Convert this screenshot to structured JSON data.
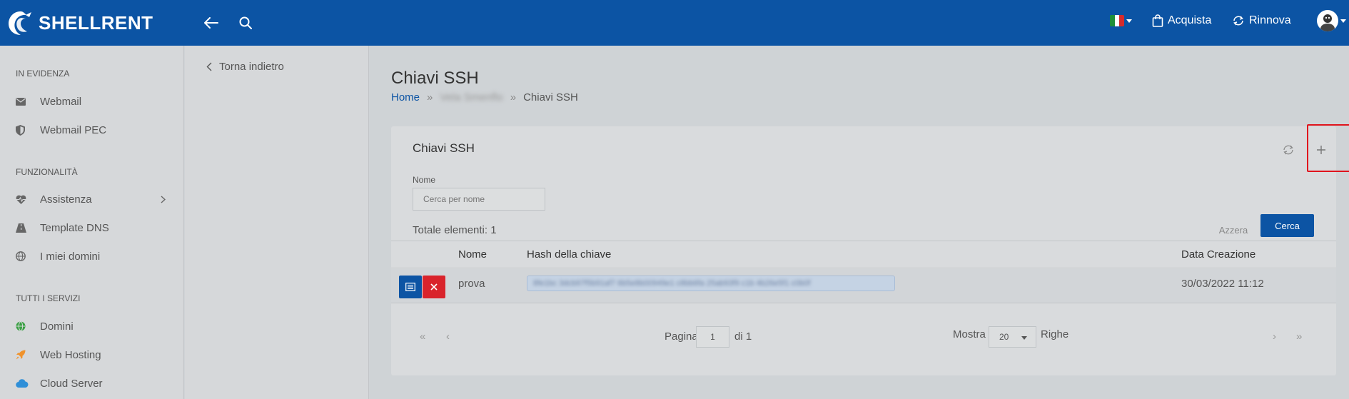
{
  "brand": {
    "name": "SHELLRENT"
  },
  "topbar": {
    "acquista_label": "Acquista",
    "rinnova_label": "Rinnova",
    "flag_colors": [
      "#1f8f3a",
      "#ffffff",
      "#d62b2b"
    ]
  },
  "sidebar": {
    "sections": [
      {
        "title": "IN EVIDENZA",
        "items": [
          {
            "label": "Webmail",
            "icon": "envelope-icon"
          },
          {
            "label": "Webmail PEC",
            "icon": "shield-icon"
          }
        ]
      },
      {
        "title": "FUNZIONALITÀ",
        "items": [
          {
            "label": "Assistenza",
            "icon": "heart-pulse-icon"
          },
          {
            "label": "Template DNS",
            "icon": "road-icon"
          },
          {
            "label": "I miei domini",
            "icon": "globe-icon"
          }
        ]
      },
      {
        "title": "TUTTI I SERVIZI",
        "items": [
          {
            "label": "Domini",
            "icon": "globe-icon"
          },
          {
            "label": "Web Hosting",
            "icon": "rocket-icon"
          },
          {
            "label": "Cloud Server",
            "icon": "cloud-icon"
          }
        ]
      }
    ]
  },
  "subnav": {
    "back_label": "Torna indietro"
  },
  "page": {
    "title": "Chiavi SSH",
    "breadcrumb": {
      "home": "Home",
      "middle": "Vela Smenflo",
      "current": "Chiavi SSH"
    }
  },
  "card": {
    "title": "Chiavi SSH",
    "filter": {
      "label": "Nome",
      "placeholder": "Cerca per nome"
    },
    "total_label": "Totale elementi: 1",
    "reset_label": "Azzera",
    "search_label": "Cerca",
    "table": {
      "columns": [
        "Nome",
        "Hash della chiave",
        "Data Creazione"
      ],
      "rows": [
        {
          "name": "prova",
          "hash": "8fe1bc 3dcb97f5b91af7 6b5e8b00949e1 c8bb6fa 25ab93f9 c1b 4b26e5f1 c0b0f",
          "date": "30/03/2022 11:12"
        }
      ]
    },
    "pagination": {
      "page_label": "Pagina",
      "page_value": "1",
      "of_label": "di 1",
      "show_label": "Mostra",
      "rows_value": "20",
      "rows_label": "Righe"
    }
  },
  "colors": {
    "primary": "#0c54a4",
    "danger": "#d9232b",
    "highlight": "#e0141d"
  }
}
